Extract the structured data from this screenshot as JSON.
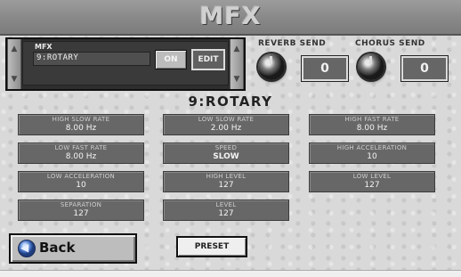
{
  "title": "MFX",
  "mfx_selector": {
    "label": "MFX",
    "value": "9:ROTARY",
    "on_label": "ON",
    "edit_label": "EDIT",
    "up_arrow": "▲",
    "down_arrow": "▼"
  },
  "sends": {
    "reverb": {
      "label": "REVERB SEND",
      "value": "0",
      "icon": "knob-icon"
    },
    "chorus": {
      "label": "CHORUS SEND",
      "value": "0",
      "icon": "knob-icon"
    }
  },
  "effect_title": "9:ROTARY",
  "parameters": [
    {
      "name": "HIGH SLOW RATE",
      "value": "8.00 Hz"
    },
    {
      "name": "LOW SLOW RATE",
      "value": "2.00 Hz"
    },
    {
      "name": "HIGH FAST RATE",
      "value": "8.00 Hz"
    },
    {
      "name": "LOW FAST RATE",
      "value": "8.00 Hz"
    },
    {
      "name": "SPEED",
      "value": "SLOW"
    },
    {
      "name": "HIGH ACCELERATION",
      "value": "10"
    },
    {
      "name": "LOW ACCELERATION",
      "value": "10"
    },
    {
      "name": "HIGH LEVEL",
      "value": "127"
    },
    {
      "name": "LOW LEVEL",
      "value": "127"
    },
    {
      "name": "SEPARATION",
      "value": "127"
    },
    {
      "name": "LEVEL",
      "value": "127"
    }
  ],
  "back_button": {
    "label": "Back",
    "icon": "back-arrow-icon",
    "glyph": "◀"
  },
  "preset_button": {
    "label": "PRESET"
  },
  "colors": {
    "title_bar": "#888888",
    "panel": "#676767",
    "background": "#d9d9d9"
  }
}
